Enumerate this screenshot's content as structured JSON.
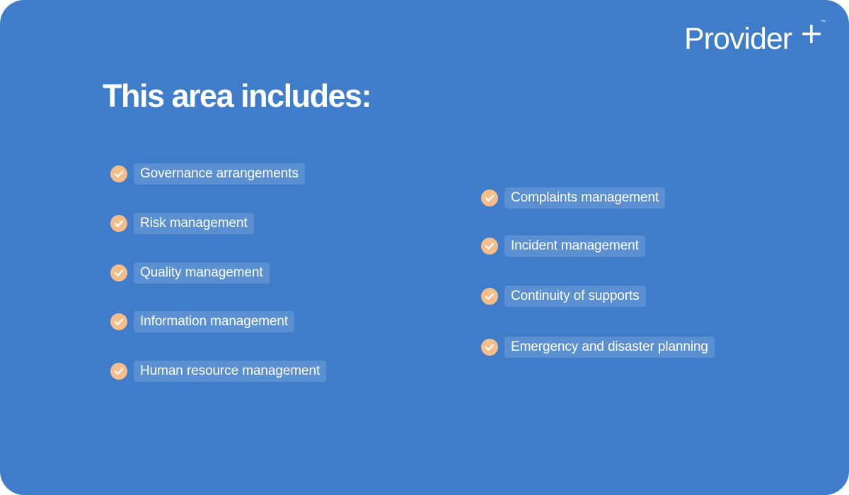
{
  "brand": {
    "name": "Provider",
    "plus": "+",
    "trademark": "™"
  },
  "heading": "This area includes:",
  "colors": {
    "background": "#3f7dcb",
    "check": "#f5bd8a",
    "text": "#ffffff"
  },
  "left_items": [
    {
      "label": "Governance arrangements",
      "icon": "check-circle-icon"
    },
    {
      "label": "Risk management",
      "icon": "check-circle-icon"
    },
    {
      "label": "Quality management",
      "icon": "check-circle-icon"
    },
    {
      "label": "Information management",
      "icon": "check-circle-icon"
    },
    {
      "label": "Human resource management",
      "icon": "check-circle-icon"
    }
  ],
  "right_items": [
    {
      "label": "Complaints management",
      "icon": "check-circle-icon"
    },
    {
      "label": "Incident management",
      "icon": "check-circle-icon"
    },
    {
      "label": "Continuity of supports",
      "icon": "check-circle-icon"
    },
    {
      "label": "Emergency and disaster planning",
      "icon": "check-circle-icon"
    }
  ]
}
